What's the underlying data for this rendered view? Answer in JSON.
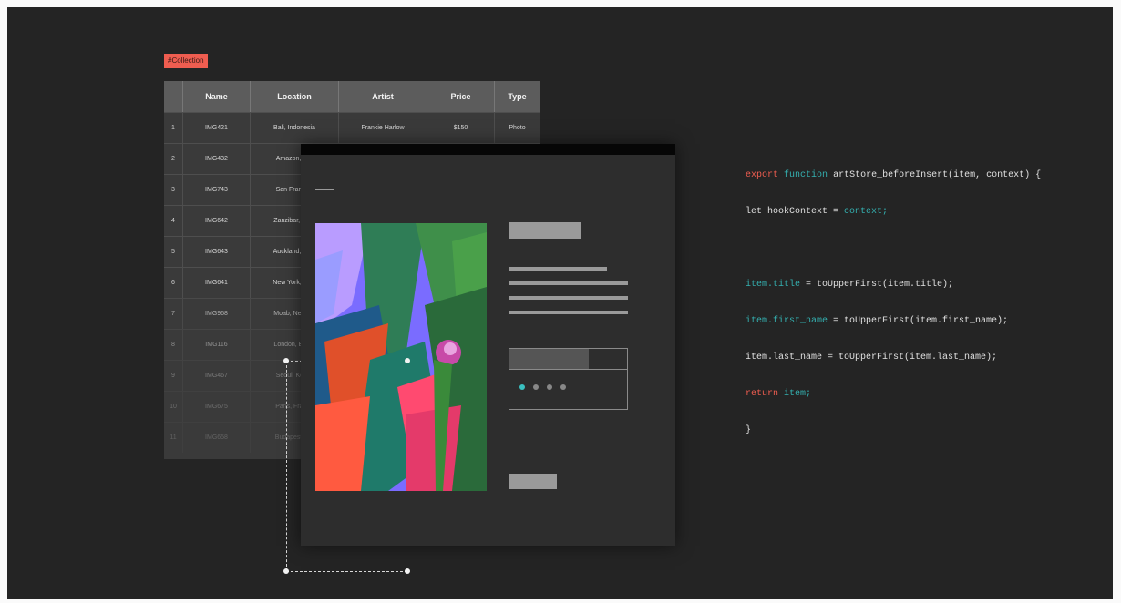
{
  "collection_tag": "#Collection",
  "table": {
    "columns": [
      "",
      "Name",
      "Location",
      "Artist",
      "Price",
      "Type"
    ],
    "rows": [
      {
        "num": "1",
        "name": "IMG421",
        "location": "Bali, Indonesia",
        "artist": "Frankie Harlow",
        "price": "$150",
        "type": "Photo"
      },
      {
        "num": "2",
        "name": "IMG432",
        "location": "Amazon, Bra",
        "artist": "",
        "price": "",
        "type": ""
      },
      {
        "num": "3",
        "name": "IMG743",
        "location": "San Francisc",
        "artist": "",
        "price": "",
        "type": ""
      },
      {
        "num": "4",
        "name": "IMG642",
        "location": "Zanzibar, Tanz",
        "artist": "",
        "price": "",
        "type": ""
      },
      {
        "num": "5",
        "name": "IMG643",
        "location": "Auckland, New",
        "artist": "",
        "price": "",
        "type": ""
      },
      {
        "num": "6",
        "name": "IMG641",
        "location": "New York, New",
        "artist": "",
        "price": "",
        "type": ""
      },
      {
        "num": "7",
        "name": "IMG968",
        "location": "Moab, Nevada",
        "artist": "",
        "price": "",
        "type": ""
      },
      {
        "num": "8",
        "name": "IMG116",
        "location": "London, Engla",
        "artist": "",
        "price": "",
        "type": ""
      },
      {
        "num": "9",
        "name": "IMG467",
        "location": "Seoul, Korea",
        "artist": "",
        "price": "",
        "type": ""
      },
      {
        "num": "10",
        "name": "IMG675",
        "location": "Paris, France",
        "artist": "",
        "price": "",
        "type": ""
      },
      {
        "num": "11",
        "name": "IMG658",
        "location": "Budapest, Hu",
        "artist": "",
        "price": "",
        "type": ""
      }
    ]
  },
  "carousel": {
    "dots": 4,
    "active_dot": 1
  },
  "code": {
    "line1": {
      "kw": "export",
      "fn_kw": "function",
      "name": "artStore_beforeInsert(item, context) {"
    },
    "line2": {
      "pre": "let hookContext = ",
      "ctx": "context;"
    },
    "line3": {
      "prop": "item.title",
      "rest": " = toUpperFirst(item.title);"
    },
    "line4": {
      "prop": "item.first_name",
      "rest": " = toUpperFirst(item.first_name);"
    },
    "line5": {
      "text": "item.last_name = toUpperFirst(item.last_name);"
    },
    "line6": {
      "kw": "return",
      "val": "item;"
    },
    "line7": {
      "text": "}"
    }
  },
  "colors": {
    "accent": "#ef5d50",
    "code_highlight": "#34b0b0",
    "background": "#242424"
  }
}
